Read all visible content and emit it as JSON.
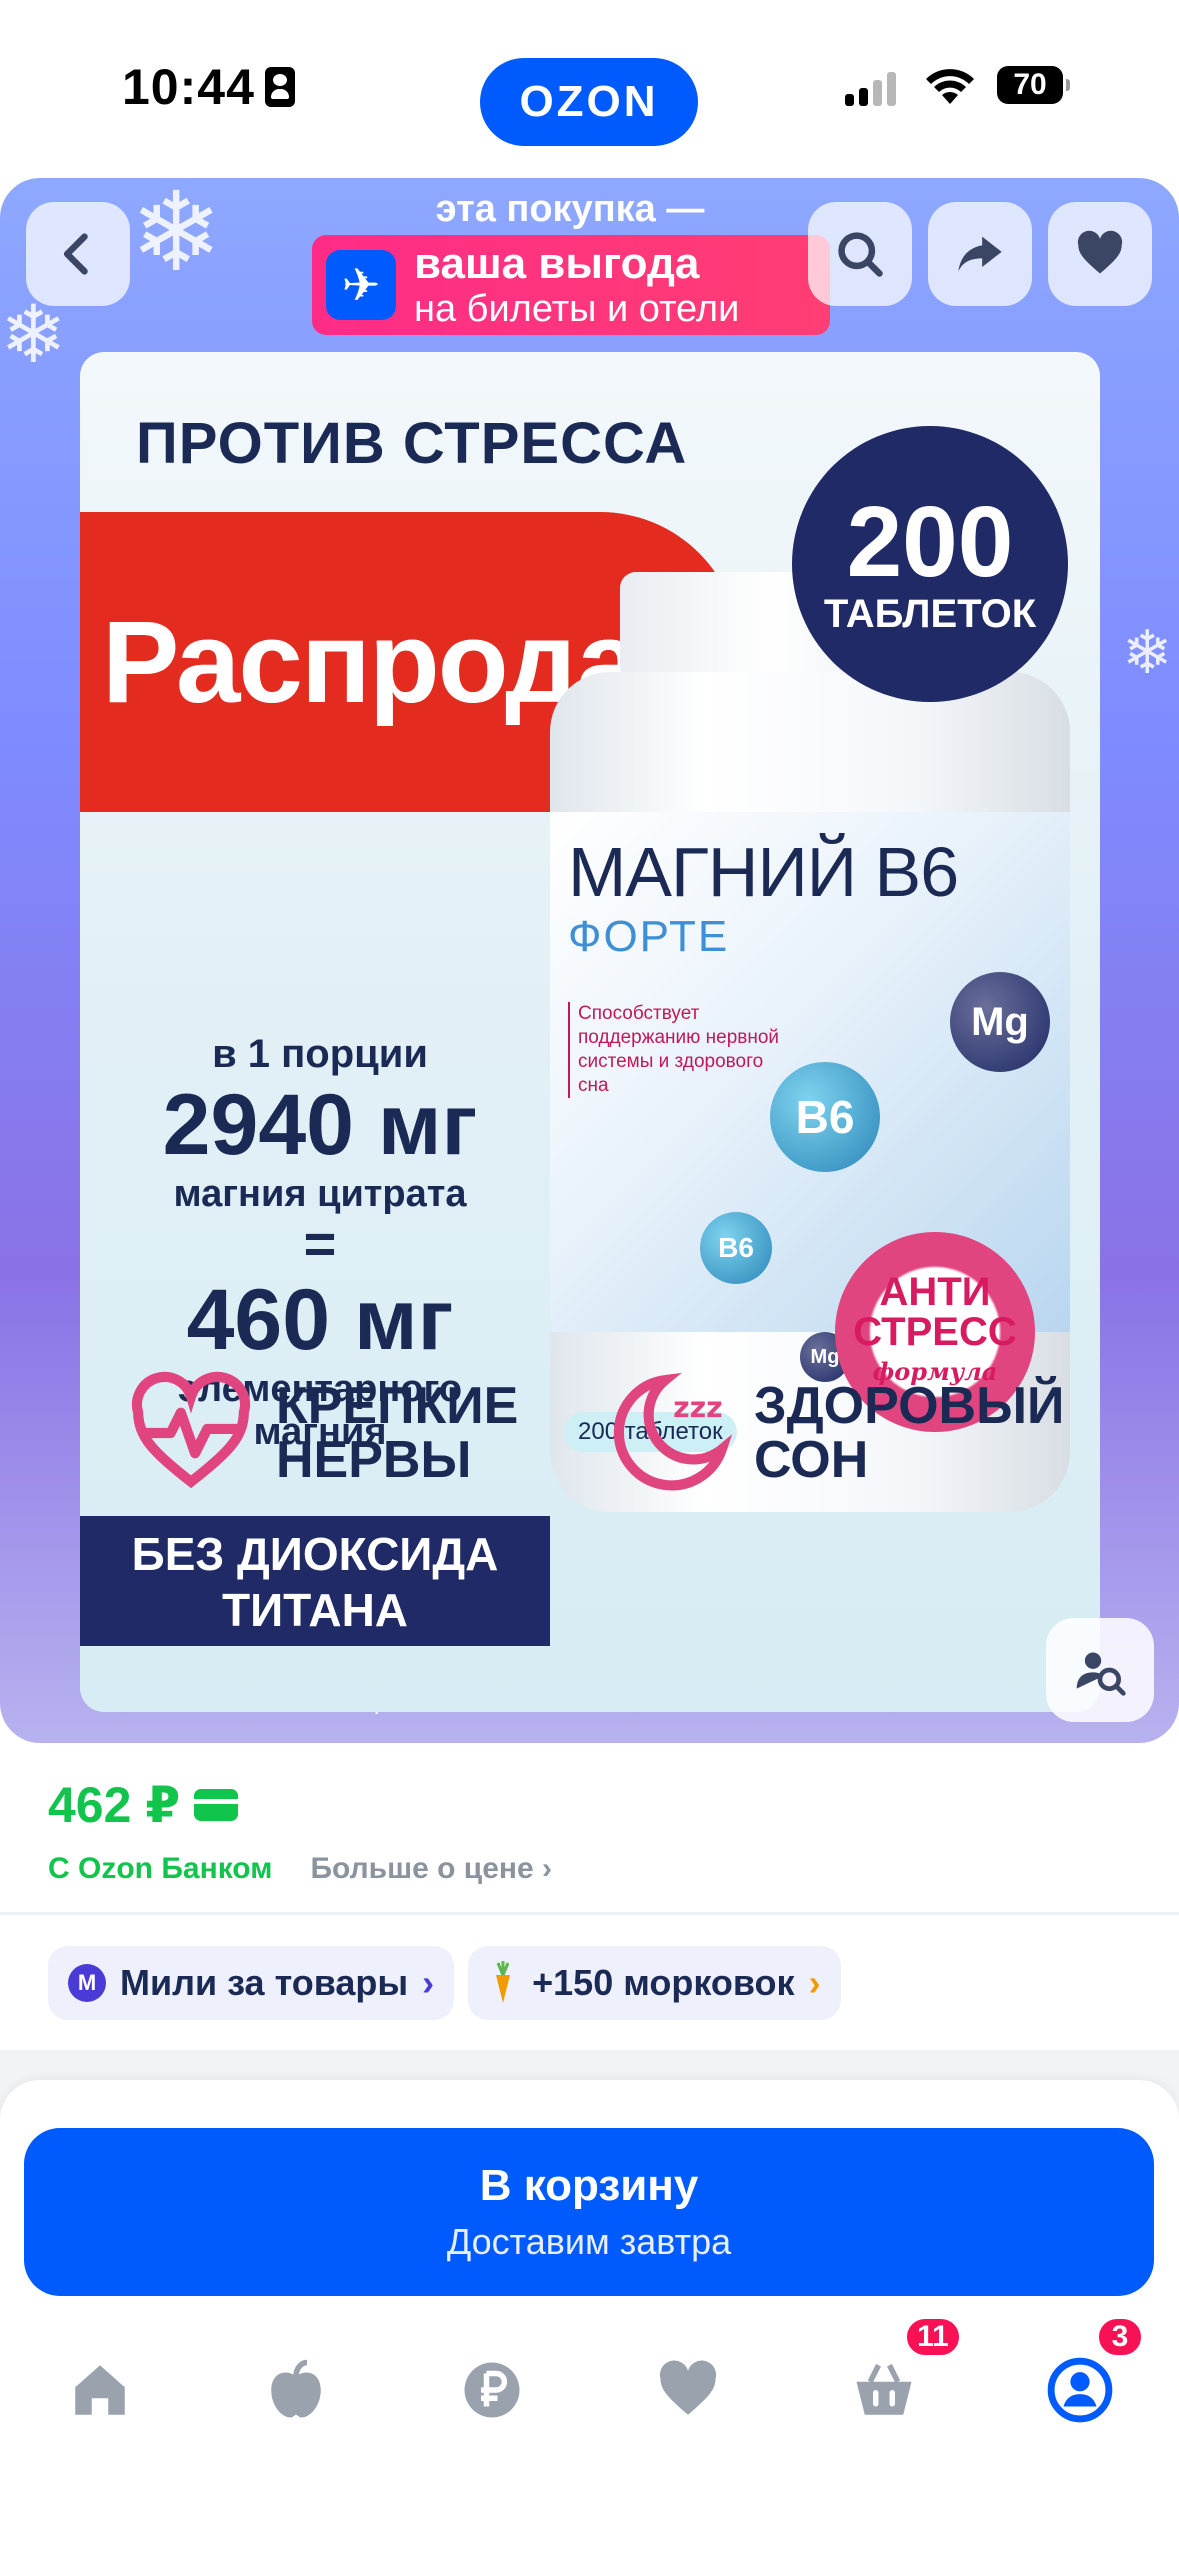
{
  "status_bar": {
    "time": "10:44",
    "battery": "70",
    "brand": "OZON"
  },
  "hero": {
    "promo_top": "эта покупка —",
    "promo_big": "ваша выгода",
    "promo_small": "на билеты и отели",
    "banner": {
      "headline": "ПРОТИВ СТРЕССА",
      "sale": "Распродажа",
      "badge_number": "200",
      "badge_label": "ТАБЛЕТОК",
      "dose_intro": "в 1 порции",
      "dose_amount": "2940 мг",
      "dose_substance": "магния цитрата",
      "dose_equals": "=",
      "elem_amount": "460 мг",
      "elem_line1": "элементарного",
      "elem_line2": "магния",
      "titan_line1": "БЕЗ ДИОКСИДА",
      "titan_line2": "ТИТАНА",
      "product_name": "МАГНИЙ В6",
      "product_sub": "ФОРТЕ",
      "product_desc": "Способствует поддержанию нервной системы и здорового сна",
      "product_pill": "200 таблеток",
      "anti_line1": "АНТИ",
      "anti_line2": "СТРЕСС",
      "anti_line3": "формула",
      "feature1_line1": "КРЕПКИЕ",
      "feature1_line2": "НЕРВЫ",
      "feature2_line1": "ЗДОРОВЫЙ",
      "feature2_line2": "СОН",
      "mol_b6": "B6",
      "mol_mg": "Mg"
    }
  },
  "price": {
    "value": "462 ₽",
    "bank_note": "С Ozon Банком",
    "more_link": "Больше о цене"
  },
  "chips": {
    "miles": "Мили за товары",
    "miles_icon": "М",
    "carrots": "+150 морковок"
  },
  "cart": {
    "button": "В корзину",
    "delivery": "Доставим завтра"
  },
  "tabbar": {
    "cart_badge": "11",
    "profile_badge": "3"
  },
  "colors": {
    "accent": "#005bff",
    "price": "#10c44c",
    "badge": "#f91155"
  }
}
